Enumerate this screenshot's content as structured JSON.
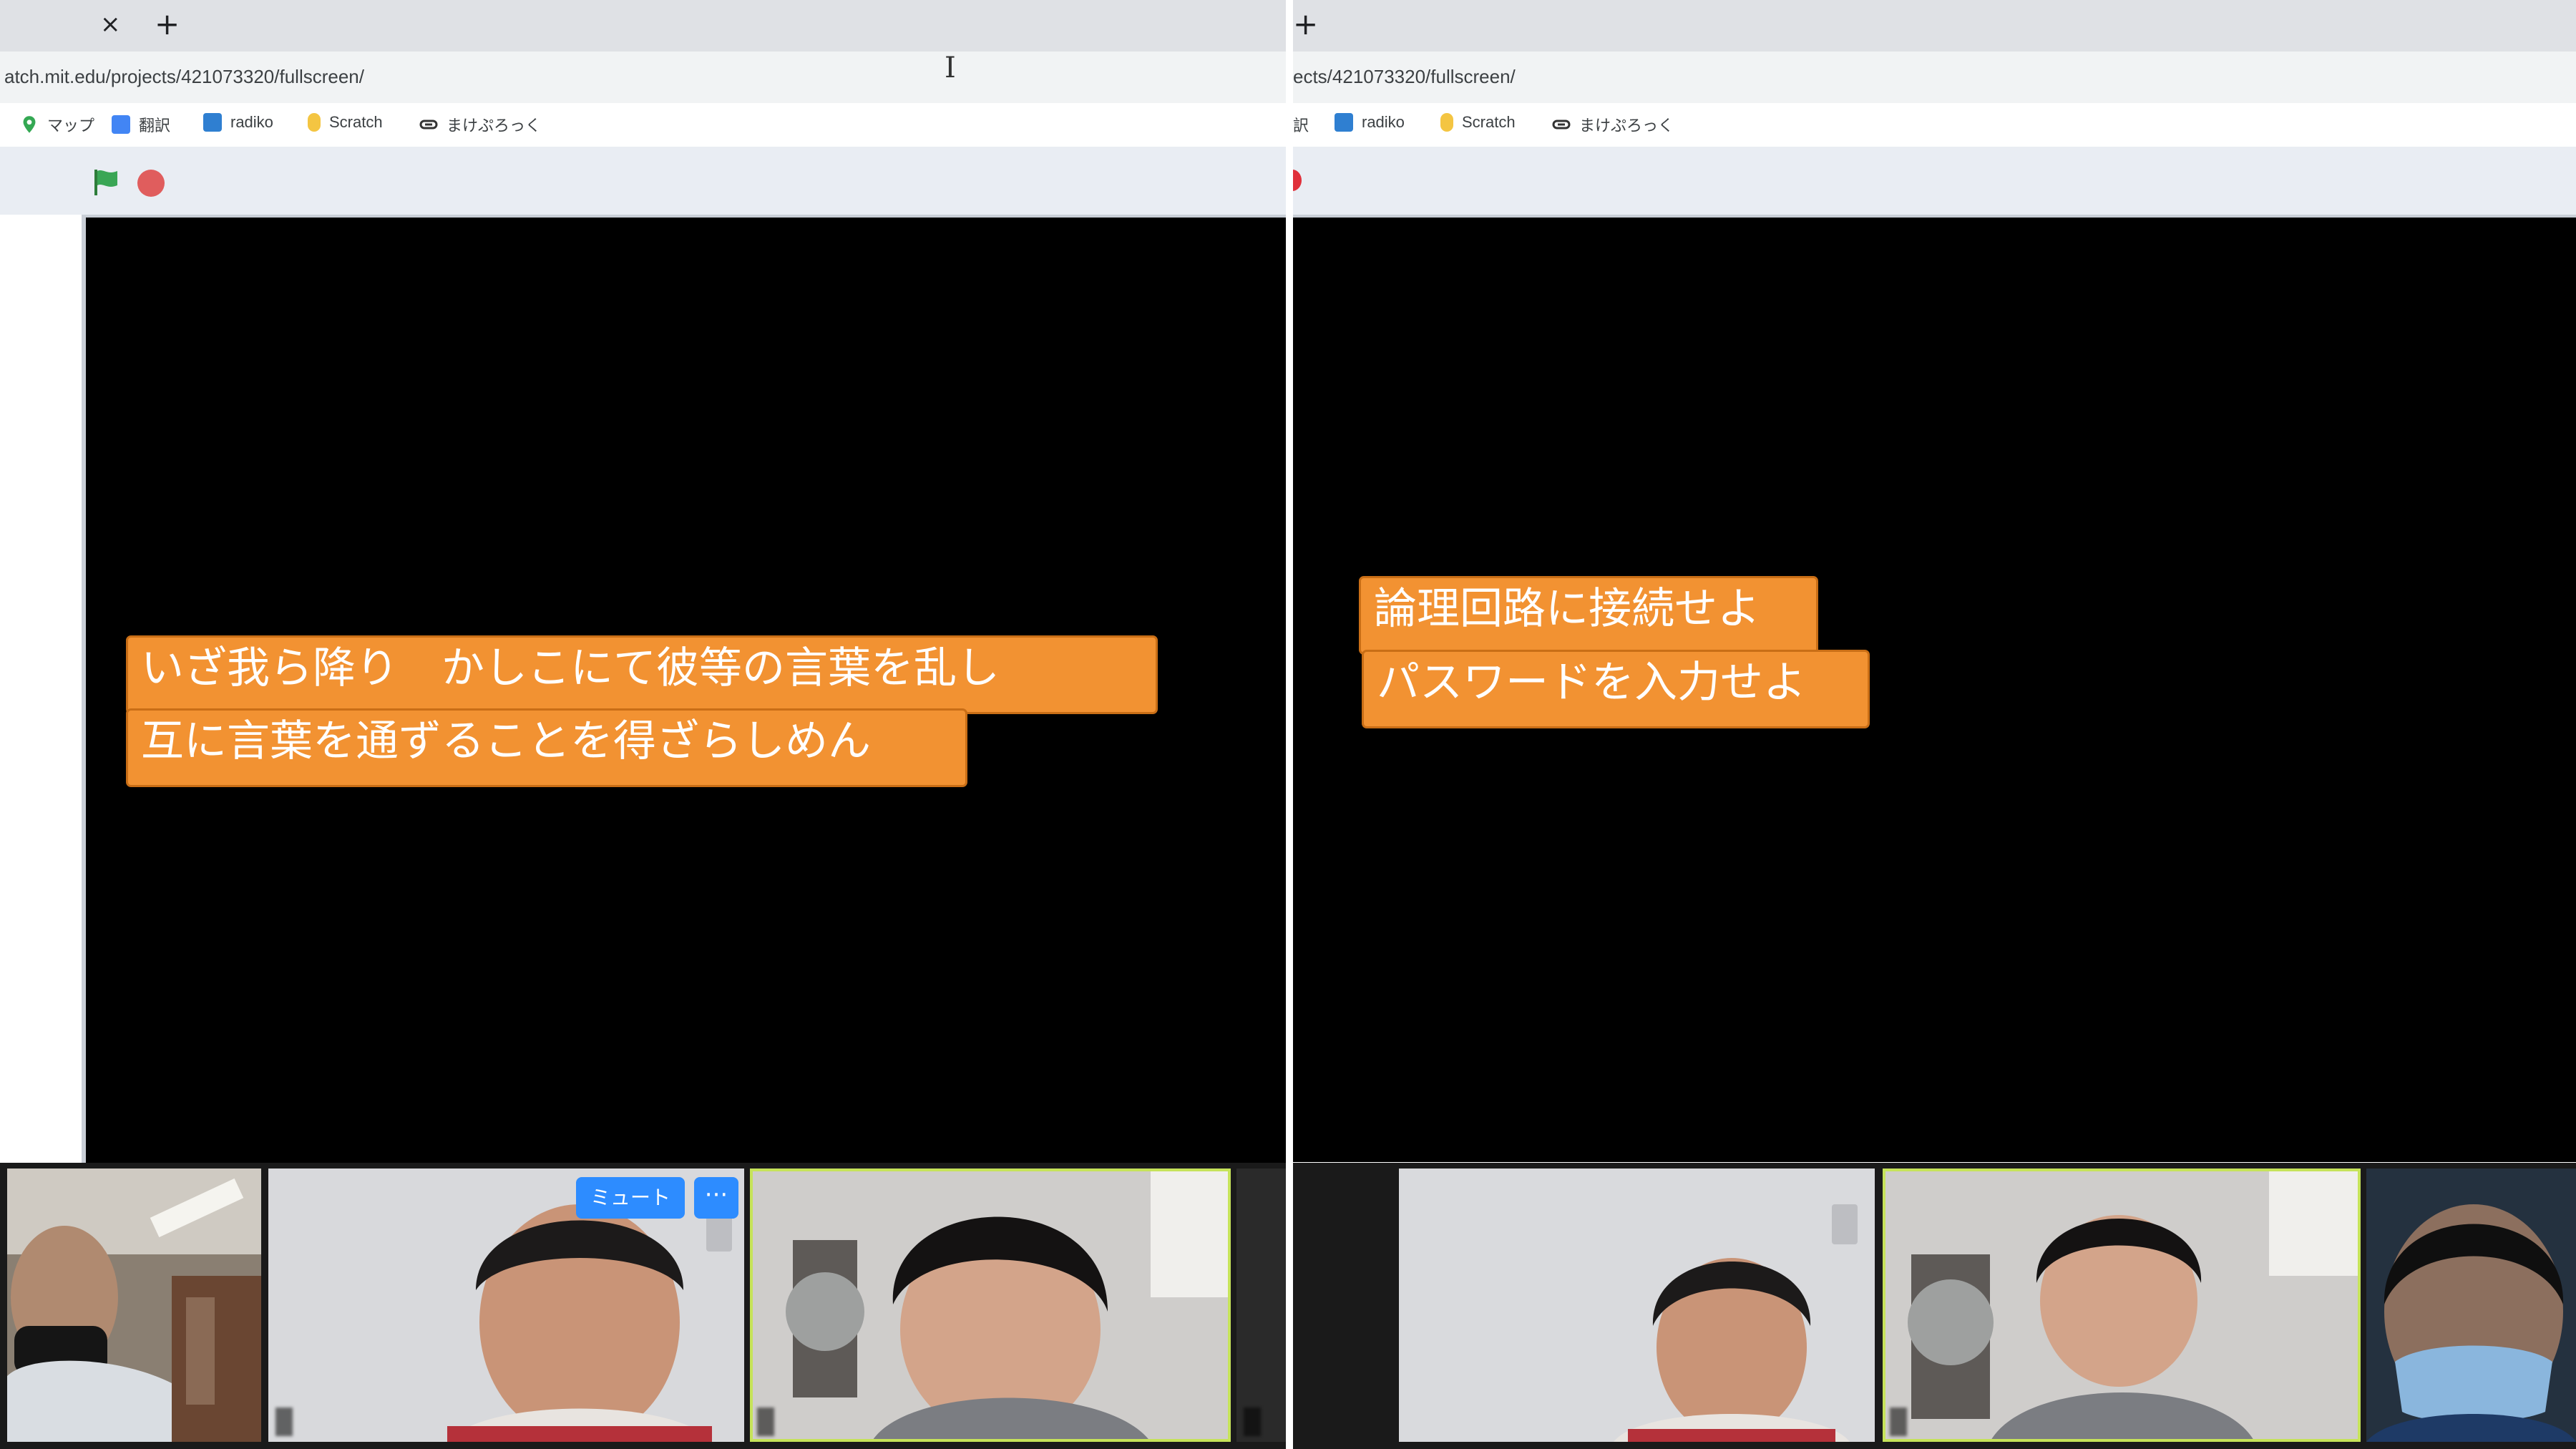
{
  "left": {
    "url": "atch.mit.edu/projects/421073320/fullscreen/",
    "tab_close": "×",
    "tab_add": "+",
    "bookmarks": [
      {
        "label": "マップ",
        "icon": "maps-pin-icon",
        "color": "#34a853"
      },
      {
        "label": "翻訳",
        "icon": "translate-icon",
        "color": "#4285f4"
      },
      {
        "label": "radiko",
        "icon": "radiko-icon",
        "color": "#2f7fd1"
      },
      {
        "label": "Scratch",
        "icon": "scratch-icon",
        "color": "#f4c542"
      },
      {
        "label": "まけぷろっく",
        "icon": "link-icon",
        "color": "#333333"
      }
    ],
    "speech": [
      "いざ我ら降り　かしこにて彼等の言葉を乱し",
      "互に言葉を通ずることを得ざらしめん"
    ],
    "meeting": {
      "mute_label": "ミュート",
      "more_label": "···",
      "names": [
        "",
        "",
        ""
      ]
    }
  },
  "right": {
    "url": "ects/421073320/fullscreen/",
    "tab_add": "+",
    "bookmarks": [
      {
        "label": "訳",
        "icon": "translate-icon",
        "color": "#4285f4"
      },
      {
        "label": "radiko",
        "icon": "radiko-icon",
        "color": "#2f7fd1"
      },
      {
        "label": "Scratch",
        "icon": "scratch-icon",
        "color": "#f4c542"
      },
      {
        "label": "まけぷろっく",
        "icon": "link-icon",
        "color": "#333333"
      }
    ],
    "speech": [
      "論理回路に接続せよ",
      "パスワードを入力せよ"
    ],
    "meeting": {
      "names": [
        ""
      ]
    }
  },
  "colors": {
    "bubble": "#f29232",
    "stage": "#000000",
    "flag": "#3aa655",
    "stop": "#e05d5d",
    "active_speaker": "#c6e35a",
    "mute": "#2d8cff"
  }
}
